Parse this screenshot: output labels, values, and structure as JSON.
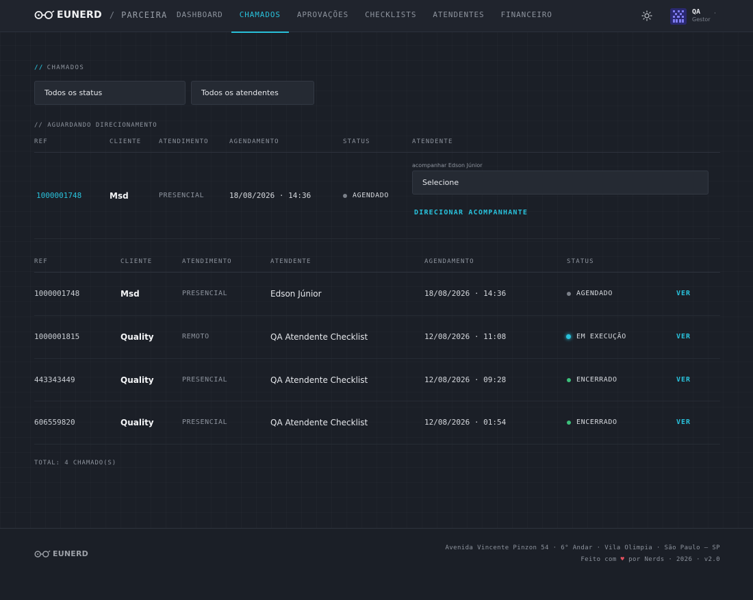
{
  "header": {
    "brand": "EUNERD",
    "separator": "/",
    "subtitle": "PARCEIRA",
    "nav": [
      {
        "label": "DASHBOARD",
        "active": false
      },
      {
        "label": "CHAMADOS",
        "active": true
      },
      {
        "label": "APROVAÇÕES",
        "active": false
      },
      {
        "label": "CHECKLISTS",
        "active": false
      },
      {
        "label": "ATENDENTES",
        "active": false
      },
      {
        "label": "FINANCEIRO",
        "active": false
      }
    ],
    "user": {
      "name": "QA",
      "role": "Gestor"
    },
    "theme_icon": "sun-icon",
    "accent_color": "#29c2dc"
  },
  "page": {
    "section_prefix": "//",
    "section_title": "CHAMADOS",
    "filters": {
      "status": "Todos os status",
      "atendentes": "Todos os atendentes"
    }
  },
  "pending": {
    "title": "// AGUARDANDO DIRECIONAMENTO",
    "columns": [
      "REF",
      "CLIENTE",
      "ATENDIMENTO",
      "AGENDAMENTO",
      "STATUS",
      "ATENDENTE"
    ],
    "row": {
      "ref": "1000001748",
      "cliente": "Msd",
      "atendimento": "PRESENCIAL",
      "agendamento": "18/08/2026 · 14:36",
      "status": "AGENDADO",
      "acompanhar_label": "acompanhar Edson Júnior",
      "select_value": "Selecione",
      "action": "DIRECIONAR ACOMPANHANTE"
    }
  },
  "table": {
    "columns": [
      "REF",
      "CLIENTE",
      "ATENDIMENTO",
      "ATENDENTE",
      "AGENDAMENTO",
      "STATUS"
    ],
    "rows": [
      {
        "ref": "1000001748",
        "cliente": "Msd",
        "atendimento": "PRESENCIAL",
        "atendente": "Edson Júnior",
        "agendamento": "18/08/2026 · 14:36",
        "status": "AGENDADO",
        "status_color": "#7b8089",
        "action": "VER"
      },
      {
        "ref": "1000001815",
        "cliente": "Quality",
        "atendimento": "REMOTO",
        "atendente": "QA Atendente Checklist",
        "agendamento": "12/08/2026 · 11:08",
        "status": "EM EXECUÇÃO",
        "status_color": "#29c2dc",
        "action": "VER"
      },
      {
        "ref": "443343449",
        "cliente": "Quality",
        "atendimento": "PRESENCIAL",
        "atendente": "QA Atendente Checklist",
        "agendamento": "12/08/2026 · 09:28",
        "status": "ENCERRADO",
        "status_color": "#3cc07a",
        "action": "VER"
      },
      {
        "ref": "606559820",
        "cliente": "Quality",
        "atendimento": "PRESENCIAL",
        "atendente": "QA Atendente Checklist",
        "agendamento": "12/08/2026 · 01:54",
        "status": "ENCERRADO",
        "status_color": "#3cc07a",
        "action": "VER"
      }
    ],
    "total": "TOTAL: 4 CHAMADO(S)"
  },
  "footer": {
    "brand": "EUNERD",
    "address": "Avenida Vincente Pinzon 54 · 6° Andar · Vila Olimpia · São Paulo — SP",
    "made_prefix": "Feito com",
    "made_suffix": "por Nerds · 2026 · v2.0"
  }
}
